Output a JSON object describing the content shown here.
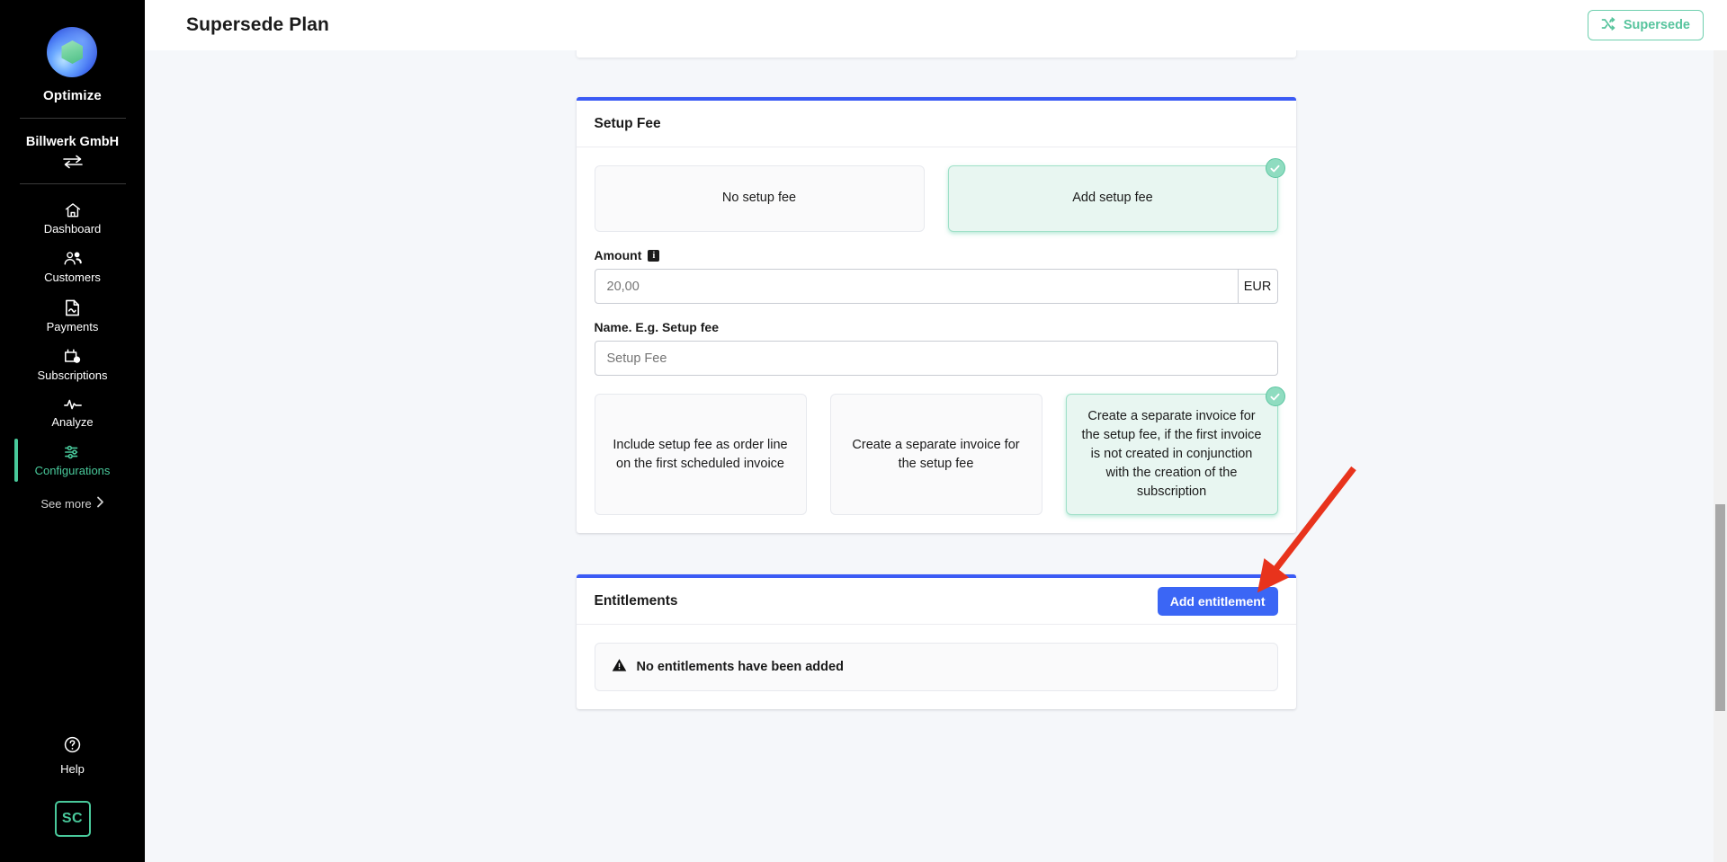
{
  "sidebar": {
    "brand": "Optimize",
    "org": "Billwerk GmbH",
    "swap_icon": "swap-horizontal-icon",
    "nav": [
      {
        "label": "Dashboard",
        "icon": "home-icon",
        "active": false
      },
      {
        "label": "Customers",
        "icon": "users-icon",
        "active": false
      },
      {
        "label": "Payments",
        "icon": "document-icon",
        "active": false
      },
      {
        "label": "Subscriptions",
        "icon": "calendar-clock-icon",
        "active": false
      },
      {
        "label": "Analyze",
        "icon": "pulse-icon",
        "active": false
      },
      {
        "label": "Configurations",
        "icon": "sliders-icon",
        "active": true
      }
    ],
    "see_more": "See more",
    "help": "Help",
    "user_initials": "SC"
  },
  "topbar": {
    "title": "Supersede Plan",
    "supersede_button": "Supersede",
    "supersede_icon": "shuffle-icon"
  },
  "setup_fee_card": {
    "title": "Setup Fee",
    "mode_options": [
      {
        "label": "No setup fee",
        "selected": false
      },
      {
        "label": "Add setup fee",
        "selected": true
      }
    ],
    "amount_label": "Amount",
    "amount_info_icon": "info-icon",
    "amount_value": "20,00",
    "amount_placeholder": "20,00",
    "currency": "EUR",
    "name_label": "Name. E.g. Setup fee",
    "name_value": "Setup Fee",
    "name_placeholder": "Setup Fee",
    "invoice_options": [
      {
        "label": "Include setup fee as order line on the first scheduled invoice",
        "selected": false
      },
      {
        "label": "Create a separate invoice for the setup fee",
        "selected": false
      },
      {
        "label": "Create a separate invoice for the setup fee, if the first invoice is not created in conjunction with the creation of the subscription",
        "selected": true
      }
    ]
  },
  "entitlements_card": {
    "title": "Entitlements",
    "add_button": "Add entitlement",
    "empty_icon": "warning-triangle-icon",
    "empty_message": "No entitlements have been added"
  },
  "colors": {
    "accent_blue": "#3b5bf5",
    "button_blue": "#3b66f5",
    "green": "#49c99b",
    "selected_green_bg": "#e8f6f1",
    "annotation_red": "#e8331c",
    "sidebar_bg": "#000000",
    "page_bg": "#f5f7fa"
  },
  "annotation": {
    "type": "arrow",
    "points_to": "Add entitlement"
  },
  "scrollbar": {
    "orientation": "vertical",
    "thumb_top_pct": 75
  }
}
